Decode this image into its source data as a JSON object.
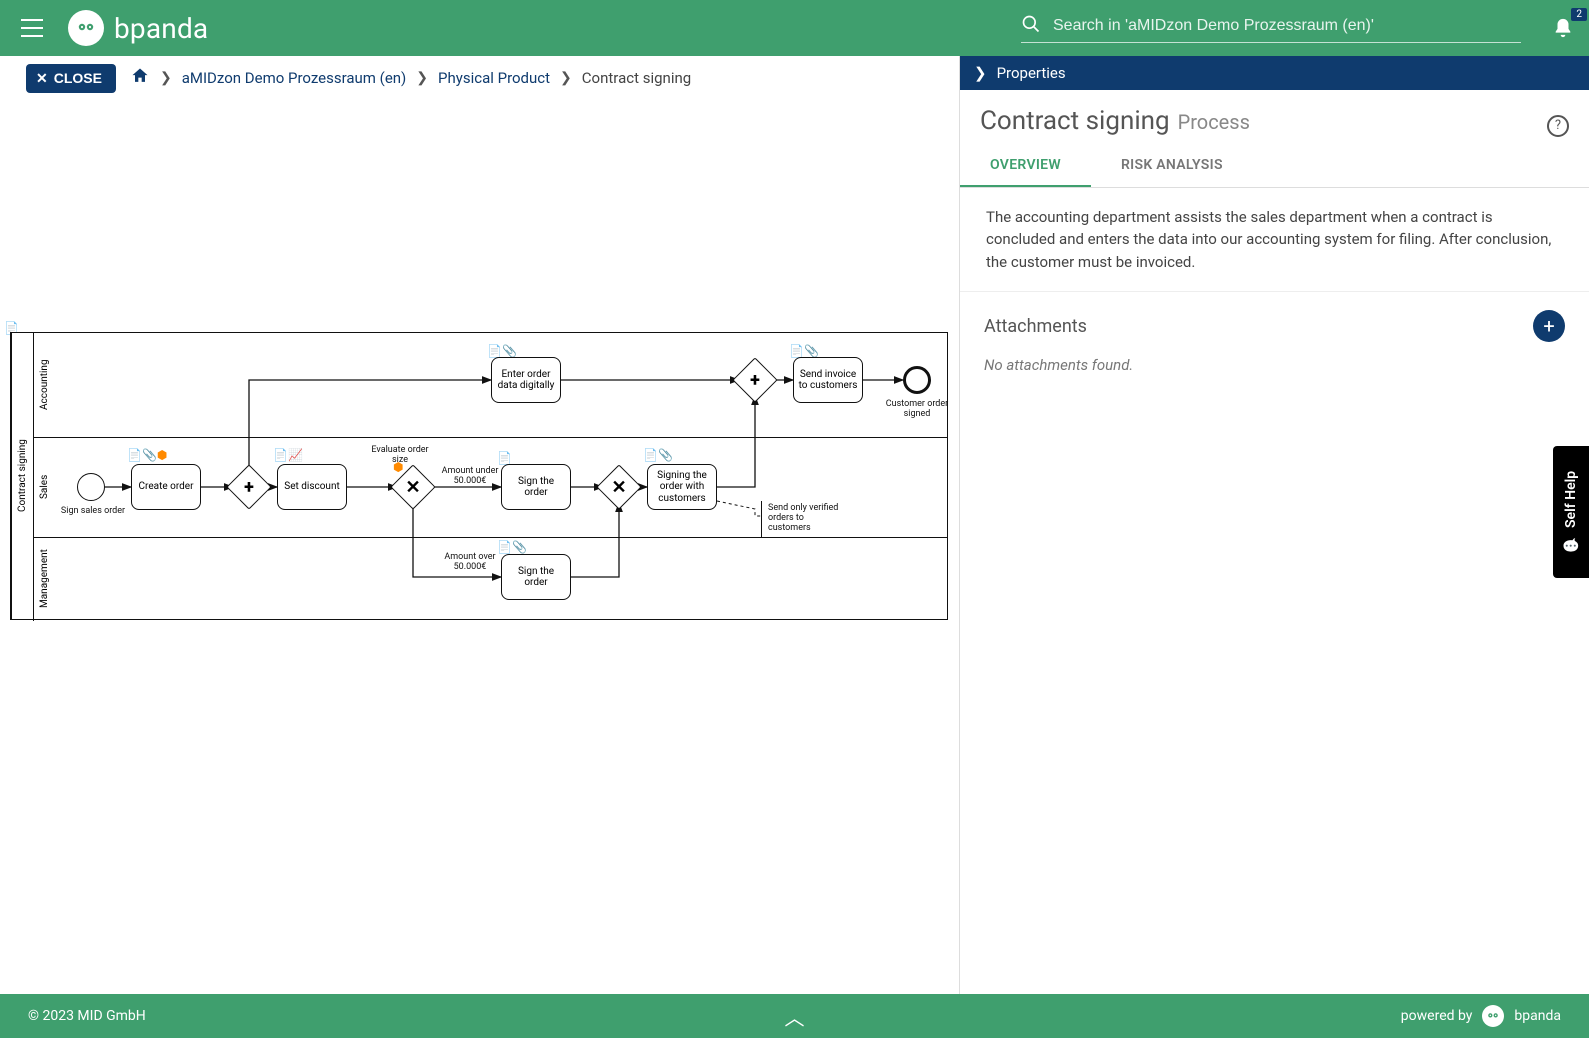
{
  "header": {
    "app_name": "bpanda",
    "search_placeholder": "Search in 'aMIDzon Demo Prozessraum (en)'",
    "notification_count": "2"
  },
  "toolbar": {
    "close_label": "CLOSE",
    "breadcrumbs": {
      "level1": "aMIDzon Demo Prozessraum (en)",
      "level2": "Physical Product",
      "current": "Contract signing"
    }
  },
  "panel": {
    "header": "Properties",
    "title": "Contract signing",
    "subtitle": "Process",
    "tabs": {
      "overview": "OVERVIEW",
      "risk": "RISK ANALYSIS"
    },
    "description": "The accounting department assists the sales department when a contract is concluded and enters the data into our accounting system for filing. After conclusion, the customer must be invoiced.",
    "attachments_title": "Attachments",
    "attachments_empty": "No attachments found."
  },
  "self_help": "Self Help",
  "diagram": {
    "pool": "Contract signing",
    "lanes": {
      "accounting": "Accounting",
      "sales": "Sales",
      "management": "Management"
    },
    "events": {
      "start": "Sign sales order",
      "end": "Customer order signed"
    },
    "tasks": {
      "create_order": "Create order",
      "set_discount": "Set discount",
      "enter_order": "Enter order data digitally",
      "sign_order_sales": "Sign the order",
      "sign_order_mgmt": "Sign the order",
      "sign_with_cust": "Signing the order with customers",
      "send_invoice": "Send invoice to customers"
    },
    "gateway_labels": {
      "evaluate": "Evaluate order size",
      "amount_under": "Amount under 50.000€",
      "amount_over": "Amount over 50.000€"
    },
    "annotation": "Send only verified orders to customers"
  },
  "footer": {
    "copyright": "© 2023 MID GmbH",
    "powered_by": "powered by",
    "brand": "bpanda"
  }
}
